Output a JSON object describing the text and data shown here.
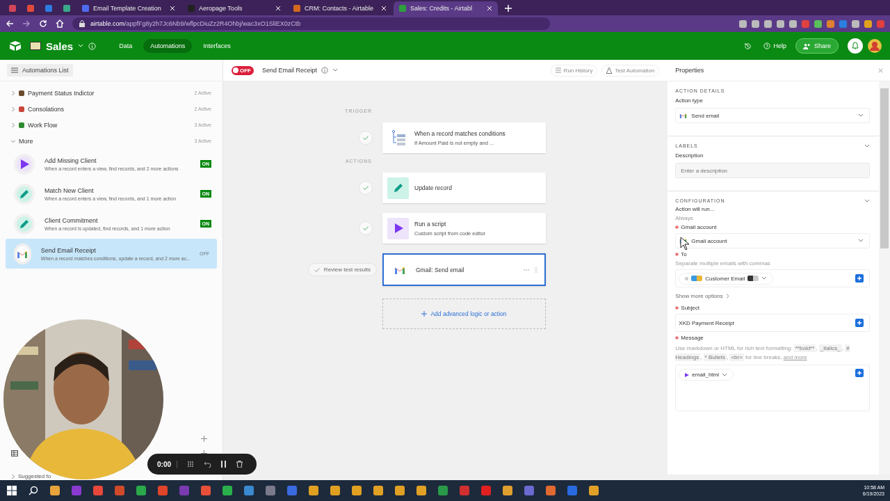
{
  "browser": {
    "tabs": [
      {
        "kind": "icon",
        "color": "#d0455a",
        "selected": false
      },
      {
        "kind": "icon",
        "color": "#e04a3a",
        "selected": false
      },
      {
        "kind": "icon",
        "color": "#2d7be0",
        "selected": false
      },
      {
        "kind": "icon",
        "color": "#3aa88a",
        "selected": false
      },
      {
        "kind": "page",
        "title": "Email Template Creation",
        "color": "#4f6bed",
        "selected": false
      },
      {
        "kind": "page",
        "title": "Aeropage Tools",
        "color": "#222222",
        "selected": false
      },
      {
        "kind": "page",
        "title": "CRM: Contacts - Airtable",
        "color": "#d2691e",
        "selected": false
      },
      {
        "kind": "page",
        "title": "Sales: Credits - Airtabl",
        "color": "#2e9e3e",
        "selected": true
      }
    ],
    "url_host": "airtable.com",
    "url_path": "/appfFg8y2h7Jc6Nb9/wflpcDiuZz2R4Ohbj/wac3xO1SliEX0zCtb"
  },
  "app_header": {
    "base_name": "Sales",
    "nav": [
      {
        "label": "Data",
        "selected": false
      },
      {
        "label": "Automations",
        "selected": true
      },
      {
        "label": "Interfaces",
        "selected": false
      }
    ],
    "help": "Help",
    "share": "Share"
  },
  "sidebar": {
    "title": "Automations List",
    "groups": [
      {
        "label": "Payment Status Indictor",
        "count": "2 Active",
        "expanded": false,
        "color": "#6b4a2a"
      },
      {
        "label": "Consolations",
        "count": "2 Active",
        "expanded": false,
        "color": "#c8473a"
      },
      {
        "label": "Work Flow",
        "count": "3 Active",
        "expanded": false,
        "color": "#2f8a2f"
      },
      {
        "label": "More",
        "count": "3 Active",
        "expanded": true,
        "automations": [
          {
            "kind": "script",
            "title": "Add Missing Client",
            "description": "When a record enters a view, find records, and 2 more actions",
            "status": "ON",
            "on": true,
            "selected": false
          },
          {
            "kind": "update",
            "title": "Match New Client",
            "description": "When a record enters a view, find records, and 1 more action",
            "status": "ON",
            "on": true,
            "selected": false
          },
          {
            "kind": "update",
            "title": "Client Commitment",
            "description": "When a record is updated, find records, and 1 more action",
            "status": "ON",
            "on": true,
            "selected": false
          },
          {
            "kind": "gmail",
            "title": "Send Email Receipt",
            "description": "When a record matches conditions, update a record, and 2 more ac...",
            "status": "OFF",
            "on": false,
            "selected": true
          }
        ]
      }
    ],
    "suggested": "Suggested fo"
  },
  "toolbar": {
    "toggle_label": "OFF",
    "on": false,
    "automation_name": "Send Email Receipt",
    "run_history": "Run History",
    "test_automation": "Test Automation"
  },
  "flow": {
    "trigger_label": "TRIGGER",
    "actions_label": "ACTIONS",
    "review": "Review test results",
    "add": "Add advanced logic or action",
    "steps": [
      {
        "kind": "trigger",
        "title": "When a record matches conditions",
        "subtitle": "If Amount Paid is not empty and ...",
        "passed": true,
        "selected": false
      },
      {
        "kind": "update",
        "title": "Update record",
        "passed": true,
        "selected": false
      },
      {
        "kind": "script",
        "title": "Run a script",
        "subtitle": "Custom script from code editor",
        "passed": true,
        "selected": false
      },
      {
        "kind": "gmail",
        "title": "Gmail: Send email",
        "passed": false,
        "selected": true
      }
    ]
  },
  "properties": {
    "title": "Properties",
    "action_details": {
      "heading": "ACTION DETAILS",
      "type_label": "Action type",
      "type_value": "Send email"
    },
    "labels": {
      "heading": "LABELS",
      "description_label": "Description",
      "description_placeholder": "Enter a description"
    },
    "configuration": {
      "heading": "CONFIGURATION",
      "run_label": "Action will run...",
      "run_value": "Always",
      "gmail": {
        "label": "Gmail account",
        "required": true,
        "value": "Gmail account"
      },
      "to": {
        "label": "To",
        "required": true,
        "hint": "Separate multiple emails with commas",
        "token": "Customer Email"
      },
      "show_more": "Show more options",
      "subject": {
        "label": "Subject",
        "required": true,
        "value": "XKD Payment Receipt"
      },
      "message": {
        "label": "Message",
        "required": true,
        "hint": [
          {
            "kind": "text",
            "text": "Use markdown or HTML for rich text formatting: "
          },
          {
            "kind": "code",
            "text": "**bold**"
          },
          {
            "kind": "text",
            "text": ", "
          },
          {
            "kind": "code",
            "text": "_italics_"
          },
          {
            "kind": "text",
            "text": ", "
          },
          {
            "kind": "code",
            "text": "# Headings"
          },
          {
            "kind": "text",
            "text": ", "
          },
          {
            "kind": "code",
            "text": "* Bullets"
          },
          {
            "kind": "text",
            "text": ", "
          },
          {
            "kind": "code",
            "text": "<br>"
          },
          {
            "kind": "text",
            "text": " for line breaks, "
          },
          {
            "kind": "link",
            "text": "and more"
          }
        ],
        "token": "email_html"
      }
    }
  },
  "recorder": {
    "time": "0:00"
  },
  "taskbar": {
    "apps": [
      {
        "color": "#e8a33a"
      },
      {
        "color": "#8a3ad0"
      },
      {
        "color": "#e8473a"
      },
      {
        "color": "#d04a2a"
      },
      {
        "color": "#2aa84a"
      },
      {
        "color": "#e0442a"
      },
      {
        "color": "#7a3ab0"
      },
      {
        "color": "#e8503a"
      },
      {
        "color": "#2ab04a"
      },
      {
        "color": "#3a8ad0"
      },
      {
        "color": "#7a7a8a"
      },
      {
        "color": "#3a6ae0"
      },
      {
        "color": "#e0a020"
      },
      {
        "color": "#e0a021"
      },
      {
        "color": "#e0a022"
      },
      {
        "color": "#e0a023"
      },
      {
        "color": "#e0a024"
      },
      {
        "color": "#e0a025"
      },
      {
        "color": "#2a9a4a"
      },
      {
        "color": "#d03030"
      },
      {
        "color": "#e02020"
      },
      {
        "color": "#e0a030"
      },
      {
        "color": "#6a6ad0"
      },
      {
        "color": "#e06a30"
      },
      {
        "color": "#2a6ae0"
      },
      {
        "color": "#e0a026"
      }
    ],
    "time": "10:58 AM",
    "date": "6/19/2023"
  }
}
